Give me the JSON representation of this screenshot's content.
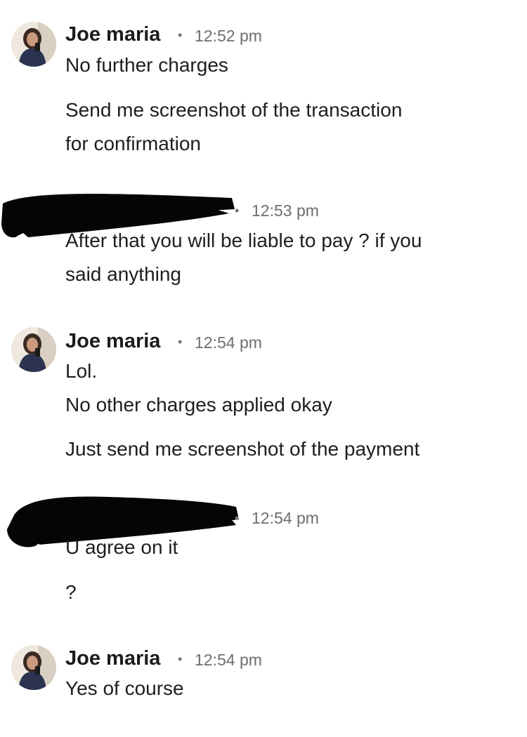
{
  "messages": [
    {
      "sender": "Joe maria",
      "time": "12:52 pm",
      "lines": [
        "No further charges"
      ],
      "extra": [
        "Send me screenshot of the transaction",
        "for confirmation"
      ]
    },
    {
      "sender": "",
      "time": "12:53 pm",
      "lines": [
        "After that you will be liable to pay ? if you",
        "said anything"
      ]
    },
    {
      "sender": "Joe maria",
      "time": "12:54 pm",
      "lines": [
        "Lol.",
        "No other charges applied okay",
        "Just send me screenshot of the payment"
      ]
    },
    {
      "sender": "",
      "time": "12:54 pm",
      "lines": [
        "U agree on it",
        "?"
      ]
    },
    {
      "sender": "Joe maria",
      "time": "12:54 pm",
      "lines": [
        "Yes of course"
      ]
    }
  ],
  "separator": "•",
  "icons": {
    "avatar": "profile-photo",
    "redaction": "black-scribble-redaction"
  },
  "colors": {
    "text": "#1e1e1e",
    "timestamp": "#6e6e6e",
    "redaction": "#050505"
  }
}
